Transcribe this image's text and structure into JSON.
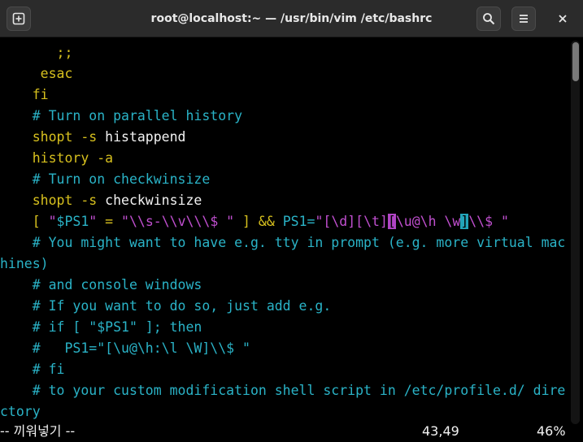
{
  "window": {
    "title": "root@localhost:~ — /usr/bin/vim /etc/bashrc"
  },
  "icons": {
    "new_tab": "new-tab-icon",
    "search": "search-icon",
    "menu": "hamburger-menu-icon",
    "close": "close-icon"
  },
  "editor": {
    "lines": [
      {
        "parts": [
          {
            "t": "       ;;",
            "c": "y"
          }
        ]
      },
      {
        "parts": [
          {
            "t": "     esac",
            "c": "y"
          }
        ]
      },
      {
        "parts": [
          {
            "t": "    fi",
            "c": "y"
          }
        ]
      },
      {
        "parts": [
          {
            "t": "    # Turn on parallel history",
            "c": "cm"
          }
        ]
      },
      {
        "parts": [
          {
            "t": "    shopt -s ",
            "c": "y"
          },
          {
            "t": "histappend",
            "c": "w"
          }
        ]
      },
      {
        "parts": [
          {
            "t": "    history -a",
            "c": "y"
          }
        ]
      },
      {
        "parts": [
          {
            "t": "    # Turn on checkwinsize",
            "c": "cm"
          }
        ]
      },
      {
        "parts": [
          {
            "t": "    shopt -s ",
            "c": "y"
          },
          {
            "t": "checkwinsize",
            "c": "w"
          }
        ]
      },
      {
        "parts": [
          {
            "t": "    [ ",
            "c": "y"
          },
          {
            "t": "\"",
            "c": "m"
          },
          {
            "t": "$PS1",
            "c": "c"
          },
          {
            "t": "\"",
            "c": "m"
          },
          {
            "t": " = ",
            "c": "y"
          },
          {
            "t": "\"\\\\s-\\\\v\\\\\\$ \"",
            "c": "m"
          },
          {
            "t": " ] && ",
            "c": "y"
          },
          {
            "t": "PS1=",
            "c": "c"
          },
          {
            "t": "\"[\\d][\\t]",
            "c": "m"
          },
          {
            "t": "[",
            "c": "hlm"
          },
          {
            "t": "\\u@\\h \\w",
            "c": "m"
          },
          {
            "t": "]",
            "c": "hlc"
          },
          {
            "t": "\\\\$ \"",
            "c": "m"
          }
        ]
      },
      {
        "parts": [
          {
            "t": "    # You might want to have e.g. tty in prompt (e.g. more virtual mac",
            "c": "cm"
          }
        ]
      },
      {
        "parts": [
          {
            "t": "hines)",
            "c": "cm"
          }
        ]
      },
      {
        "parts": [
          {
            "t": "    # and console windows",
            "c": "cm"
          }
        ]
      },
      {
        "parts": [
          {
            "t": "    # If you want to do so, just add e.g.",
            "c": "cm"
          }
        ]
      },
      {
        "parts": [
          {
            "t": "    # if [ \"$PS1\" ]; then",
            "c": "cm"
          }
        ]
      },
      {
        "parts": [
          {
            "t": "    #   PS1=\"[\\u@\\h:\\l \\W]\\\\$ \"",
            "c": "cm"
          }
        ]
      },
      {
        "parts": [
          {
            "t": "    # fi",
            "c": "cm"
          }
        ]
      },
      {
        "parts": [
          {
            "t": "    # to your custom modification shell script in /etc/profile.d/ dire",
            "c": "cm"
          }
        ]
      },
      {
        "parts": [
          {
            "t": "ctory",
            "c": "cm"
          }
        ]
      }
    ]
  },
  "statusline": {
    "mode": "-- 끼워넣기 --",
    "position": "43,49",
    "percent": "46%"
  },
  "scroll": {
    "position_fraction": 0.0
  }
}
